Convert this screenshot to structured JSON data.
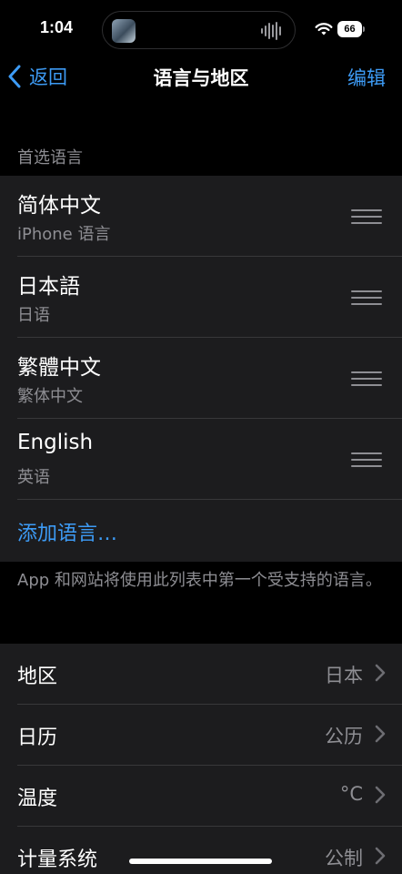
{
  "status_bar": {
    "time": "1:04",
    "battery": "66",
    "wifi_icon": "wifi-icon",
    "island_icons": [
      "album-art-icon",
      "audio-waveform-icon"
    ]
  },
  "nav": {
    "back_label": "返回",
    "title": "语言与地区",
    "edit_label": "编辑"
  },
  "preferred_languages": {
    "header": "首选语言",
    "items": [
      {
        "name": "简体中文",
        "subtitle": "iPhone 语言"
      },
      {
        "name": "日本語",
        "subtitle": "日语"
      },
      {
        "name": "繁體中文",
        "subtitle": "繁体中文"
      },
      {
        "name": "English",
        "subtitle": "英语"
      }
    ],
    "add_label": "添加语言…",
    "footer": "App 和网站将使用此列表中第一个受支持的语言。"
  },
  "region_settings": {
    "items": [
      {
        "label": "地区",
        "value": "日本"
      },
      {
        "label": "日历",
        "value": "公历"
      },
      {
        "label": "温度",
        "value": "°C"
      },
      {
        "label": "计量系统",
        "value": "公制"
      }
    ]
  },
  "colors": {
    "accent": "#3d9bf5",
    "background": "#000000",
    "cell_background": "#1c1c1e",
    "secondary_text": "#8e8e93",
    "separator": "#38383a"
  }
}
